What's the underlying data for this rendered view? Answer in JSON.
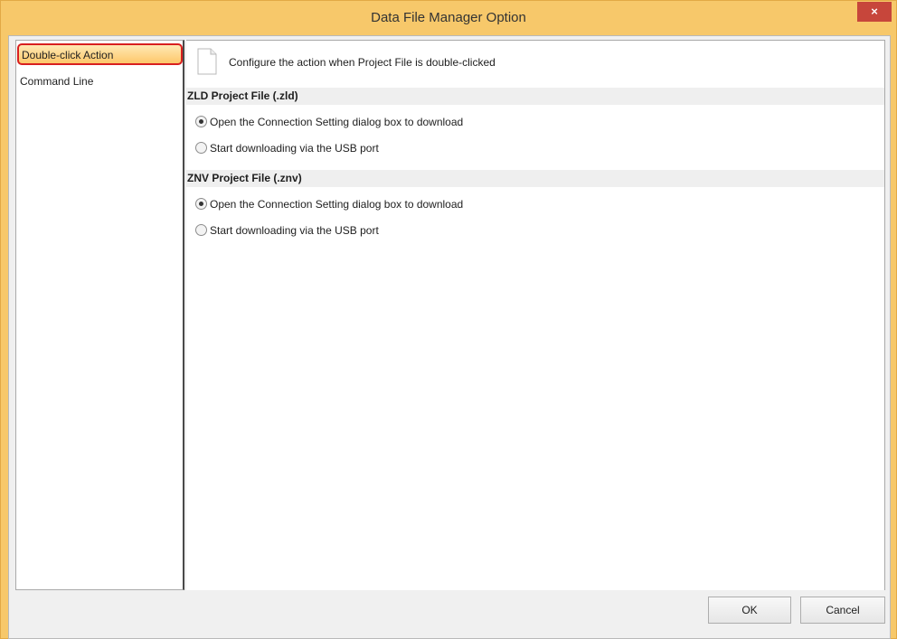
{
  "window": {
    "title": "Data File Manager Option",
    "close_glyph": "×",
    "colors": {
      "title_bar": "#f7c86a",
      "close": "#c7463b",
      "selection_border": "#d81f1f"
    }
  },
  "sidebar": {
    "items": [
      {
        "label": "Double-click Action",
        "selected": true
      },
      {
        "label": "Command Line",
        "selected": false
      }
    ]
  },
  "content": {
    "header_icon": "document-icon",
    "description": "Configure the action when Project File is double-clicked",
    "sections": [
      {
        "title": "ZLD Project File (.zld)",
        "options": [
          {
            "label": "Open the Connection Setting dialog box to download",
            "checked": true
          },
          {
            "label": "Start downloading via the USB port",
            "checked": false
          }
        ]
      },
      {
        "title": "ZNV Project File (.znv)",
        "options": [
          {
            "label": "Open the Connection Setting dialog box to download",
            "checked": true
          },
          {
            "label": "Start downloading via the USB port",
            "checked": false
          }
        ]
      }
    ]
  },
  "footer": {
    "ok_label": "OK",
    "cancel_label": "Cancel"
  }
}
